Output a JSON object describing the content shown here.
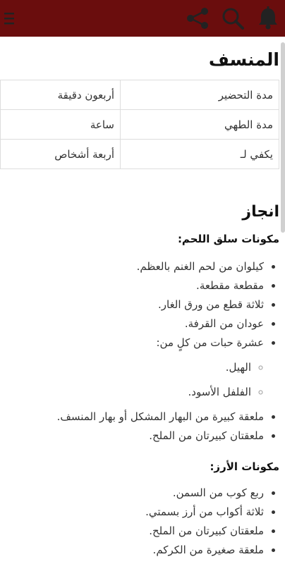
{
  "toolbar": {
    "icons": [
      "menu-icon",
      "share-icon",
      "search-icon",
      "bell-icon"
    ],
    "background": "#6a0d0d"
  },
  "recipe": {
    "title": "المنسف",
    "info": [
      {
        "label": "مدة التحضير",
        "value": "أربعون دقيقة"
      },
      {
        "label": "مدة الطهي",
        "value": "ساعة"
      },
      {
        "label": "يكفي لـ",
        "value": "أربعة أشخاص"
      }
    ]
  },
  "method": {
    "heading": "انجاز",
    "meat": {
      "heading": "مكونات سلق اللحم:",
      "items": [
        "كيلوان من لحم الغنم بالعظم.",
        "مقطعة مقطعة.",
        "ثلاثة قطع من ورق الغار.",
        "عودان من القرفة.",
        "عشرة حبات من كلٍ من:",
        "ملعقة كبيرة من البهار المشكل أو بهار المنسف.",
        "ملعقتان كبيرتان من الملح."
      ],
      "subitems": [
        "الهيل.",
        "الفلفل الأسود."
      ]
    },
    "rice": {
      "heading": "مكونات الأرز:",
      "items": [
        "ربع كوب من السمن.",
        "ثلاثة أكواب من أرز بسمتي.",
        "ملعقتان كبيرتان من الملح.",
        "ملعقة صغيرة من الكركم."
      ]
    }
  }
}
